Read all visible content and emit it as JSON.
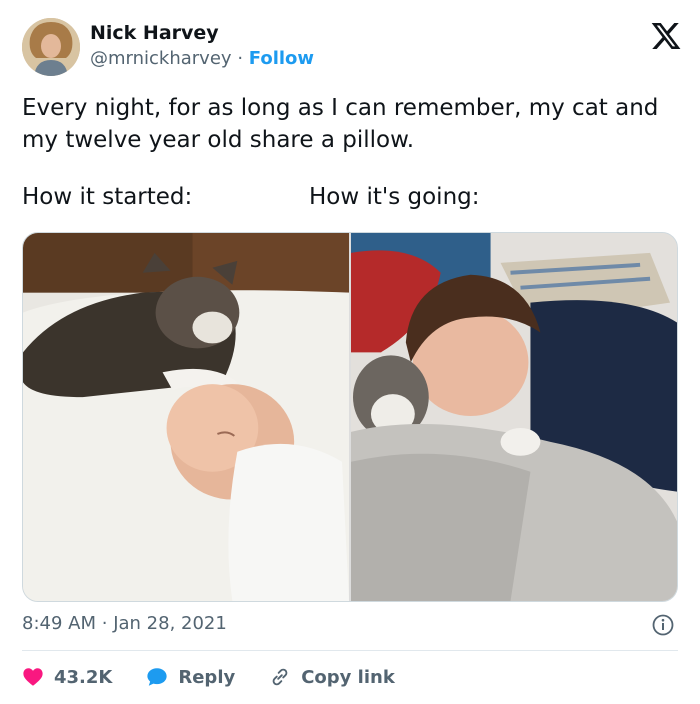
{
  "author": {
    "name": "Nick Harvey",
    "handle": "@mrnickharvey",
    "separator": "·",
    "follow_label": "Follow"
  },
  "tweet": {
    "text": "Every night, for as long as I can remember, my cat and my twelve year old share a pillow.",
    "caption_left": "How it started:",
    "caption_right": "How it's going:"
  },
  "meta": {
    "time": "8:49 AM",
    "separator": "·",
    "date": "Jan 28, 2021"
  },
  "actions": {
    "like_count": "43.2K",
    "reply_label": "Reply",
    "copy_label": "Copy link"
  },
  "icons": {
    "brand": "x-logo-icon",
    "info": "info-icon",
    "like": "heart-icon",
    "reply": "reply-bubble-icon",
    "copy": "link-icon"
  },
  "colors": {
    "accent": "#1d9bf0",
    "like": "#f91880",
    "muted": "#536471",
    "text": "#0f1419"
  }
}
